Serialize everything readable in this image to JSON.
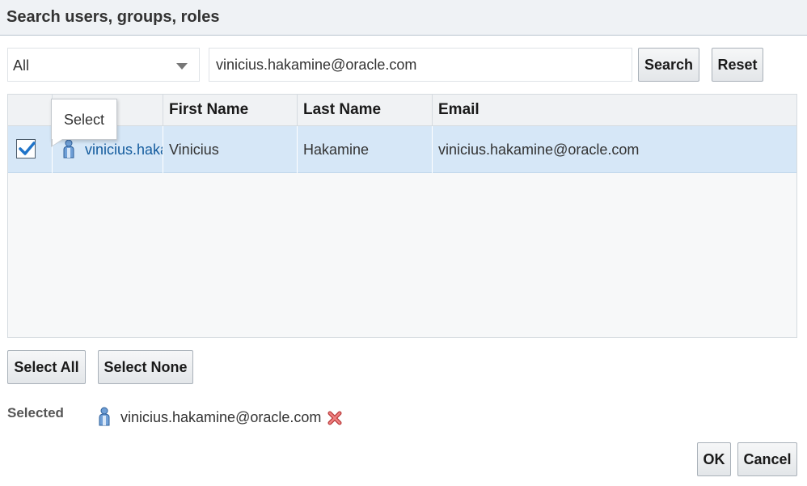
{
  "dialog": {
    "title": "Search users, groups, roles"
  },
  "search": {
    "scope_value": "All",
    "query": "vinicius.hakamine@oracle.com",
    "search_label": "Search",
    "reset_label": "Reset"
  },
  "table": {
    "columns": [
      "First Name",
      "Last Name",
      "Email"
    ],
    "rows": [
      {
        "checked": true,
        "name": "vinicius.hakamine@oracle.com",
        "first_name": "Vinicius",
        "last_name": "Hakamine",
        "email": "vinicius.hakamine@oracle.com"
      }
    ],
    "tooltip": "Select",
    "icons": {
      "user": "user-icon",
      "check": "check-icon"
    }
  },
  "selection_buttons": {
    "select_all": "Select All",
    "select_none": "Select None"
  },
  "selected": {
    "label": "Selected",
    "value": "vinicius.hakamine@oracle.com",
    "remove_icon": "remove-icon"
  },
  "footer": {
    "ok_label": "OK",
    "cancel_label": "Cancel"
  },
  "colors": {
    "selected_row": "#d6e7f7",
    "link": "#145c9e",
    "check": "#1f74c9",
    "remove": "#e05a5a"
  }
}
